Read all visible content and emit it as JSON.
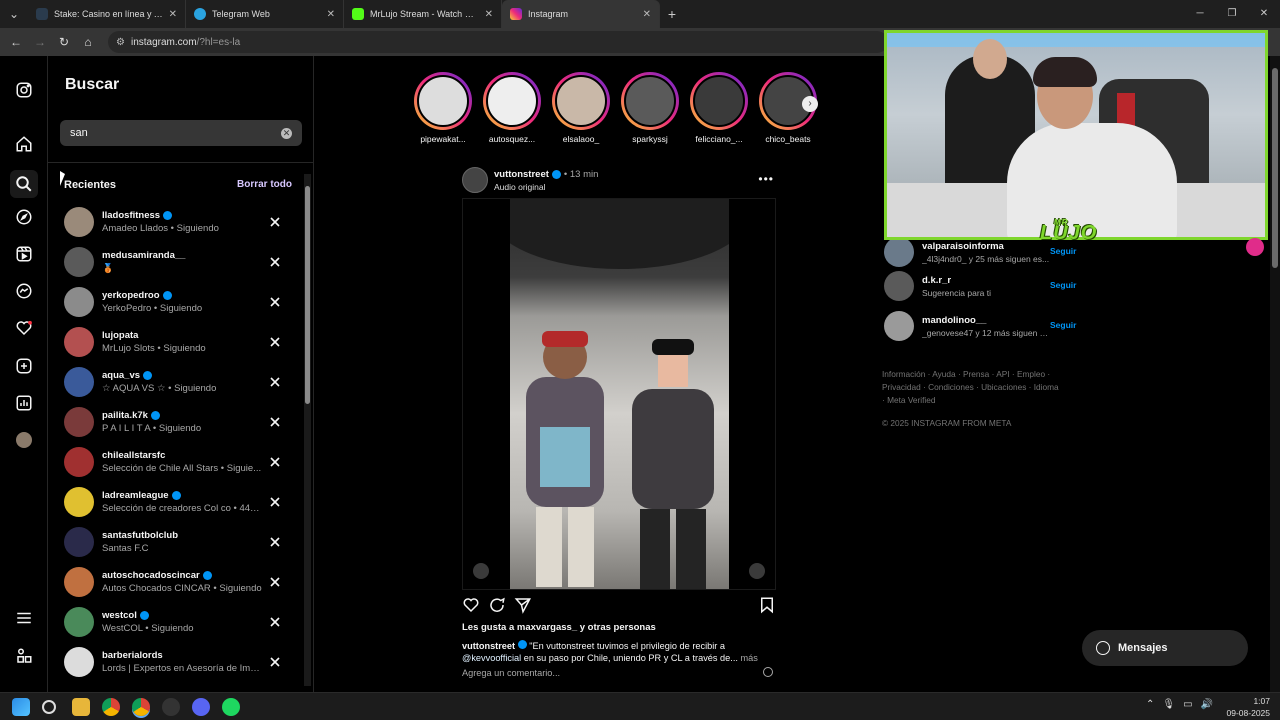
{
  "browser": {
    "tabs": [
      {
        "title": "Stake: Casino en línea y Apuestas",
        "color": "#2a3b4d"
      },
      {
        "title": "Telegram Web",
        "color": "#2aa3e0"
      },
      {
        "title": "MrLujo Stream - Watch Live on",
        "color": "#53fc18"
      },
      {
        "title": "Instagram",
        "color": "#d6249f"
      }
    ],
    "url_domain": "instagram.com",
    "url_path": "/?hl=es-la"
  },
  "search": {
    "title": "Buscar",
    "query": "san",
    "recents_label": "Recientes",
    "clear_all_label": "Borrar todo",
    "items": [
      {
        "name": "lladosfitness",
        "sub": "Amadeo Llados • Siguiendo",
        "verified": true
      },
      {
        "name": "medusamiranda__",
        "sub": "🥉",
        "verified": false
      },
      {
        "name": "yerkopedroo",
        "sub": "YerkoPedro • Siguiendo",
        "verified": true
      },
      {
        "name": "lujopata",
        "sub": "MrLujo Slots • Siguiendo",
        "verified": false
      },
      {
        "name": "aqua_vs",
        "sub": "☆ AQUA VS ☆ • Siguiendo",
        "verified": true
      },
      {
        "name": "pailita.k7k",
        "sub": "P A I L I T A • Siguiendo",
        "verified": true
      },
      {
        "name": "chileallstarsfc",
        "sub": "Selección de Chile All Stars • Siguie...",
        "verified": false
      },
      {
        "name": "ladreamleague",
        "sub": "Selección de creadores Col co • 444...",
        "verified": true
      },
      {
        "name": "santasfutbolclub",
        "sub": "Santas F.C",
        "verified": false
      },
      {
        "name": "autoschocadoscincar",
        "sub": "Autos Chocados CINCAR • Siguiendo",
        "verified": true
      },
      {
        "name": "westcol",
        "sub": "WestCOL • Siguiendo",
        "verified": true
      },
      {
        "name": "barberialords",
        "sub": "Lords | Expertos en Asesoría de Ima...",
        "verified": false
      }
    ]
  },
  "stories": [
    "pipewakat...",
    "autosquez...",
    "elsalaoo_",
    "sparkyssj",
    "felicciano_...",
    "chico_beats"
  ],
  "post": {
    "user": "vuttonstreet",
    "time": "13 min",
    "audio": "Audio original",
    "likes": "Les gusta a maxvargass_ y otras personas",
    "caption_user": "vuttonstreet",
    "caption_text": "\"En vuttonstreet tuvimos el privilegio de recibir a",
    "caption_mention": "@kevvoofficial",
    "caption_text2": "en su paso por Chile, uniendo PR y CL a través de...",
    "more": "más",
    "comment_placeholder": "Agrega un comentario..."
  },
  "suggestions": [
    {
      "name": "valparaisoinforma",
      "sub": "_4l3j4ndr0_ y 25 más siguen es...",
      "follow": "Seguir"
    },
    {
      "name": "d.k.r_r",
      "sub": "Sugerencia para ti",
      "follow": "Seguir"
    },
    {
      "name": "mandolinoo__",
      "sub": "_genovese47 y 12 más siguen es...",
      "follow": "Seguir"
    }
  ],
  "footer": {
    "links": "Información · Ayuda · Prensa · API · Empleo · Privacidad · Condiciones · Ubicaciones · Idioma · Meta Verified",
    "copyright": "© 2025 INSTAGRAM FROM META"
  },
  "messages_label": "Mensajes",
  "stream_logo": "LUJO",
  "stream_logo_small": "MR",
  "clock": {
    "time": "1:07",
    "date": "09-08-2025"
  }
}
